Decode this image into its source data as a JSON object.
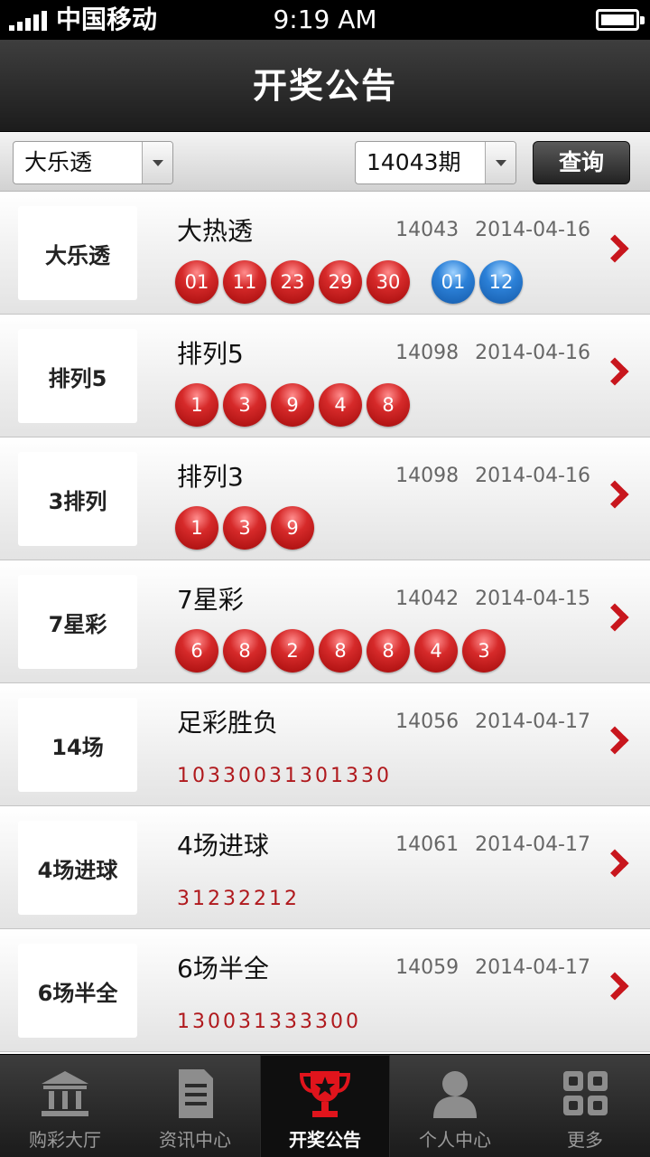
{
  "status_bar": {
    "carrier": "中国移动",
    "time": "9:19 AM",
    "icons": [
      "signal-icon",
      "battery-icon"
    ]
  },
  "header": {
    "title": "开奖公告"
  },
  "filter": {
    "lottery_select": "大乐透",
    "issue_select": "14043期",
    "query_label": "查询"
  },
  "colors": {
    "accent_red": "#c8161d",
    "red_ball": "#c01a1a",
    "blue_ball": "#2371c6",
    "result_text": "#b0191d"
  },
  "results": [
    {
      "name": "大热透",
      "logo_text": "大乐透",
      "logo_icon": "lotto-logo-dlt",
      "issue": "14043",
      "date": "2014-04-16",
      "red": [
        "01",
        "11",
        "23",
        "29",
        "30"
      ],
      "blue": [
        "01",
        "12"
      ]
    },
    {
      "name": "排列5",
      "logo_text": "排列5",
      "logo_icon": "lotto-logo-pl5",
      "issue": "14098",
      "date": "2014-04-16",
      "red": [
        "1",
        "3",
        "9",
        "4",
        "8"
      ],
      "blue": []
    },
    {
      "name": "排列3",
      "logo_text": "3排列",
      "logo_icon": "lotto-logo-pl3",
      "issue": "14098",
      "date": "2014-04-16",
      "red": [
        "1",
        "3",
        "9"
      ],
      "blue": []
    },
    {
      "name": "7星彩",
      "logo_text": "7星彩",
      "logo_icon": "lotto-logo-7xc",
      "issue": "14042",
      "date": "2014-04-15",
      "red": [
        "6",
        "8",
        "2",
        "8",
        "8",
        "4",
        "3"
      ],
      "blue": []
    },
    {
      "name": "足彩胜负",
      "logo_text": "14场",
      "logo_icon": "lotto-logo-14c",
      "issue": "14056",
      "date": "2014-04-17",
      "result_text": "10330031301330"
    },
    {
      "name": "4场进球",
      "logo_text": "4场进球",
      "logo_icon": "lotto-logo-4cjq",
      "issue": "14061",
      "date": "2014-04-17",
      "result_text": "31232212"
    },
    {
      "name": "6场半全",
      "logo_text": "6场半全",
      "logo_icon": "lotto-logo-6cbq",
      "issue": "14059",
      "date": "2014-04-17",
      "result_text": "130031333300"
    }
  ],
  "tabs": [
    {
      "label": "购彩大厅",
      "icon": "bank-icon",
      "active": false
    },
    {
      "label": "资讯中心",
      "icon": "document-icon",
      "active": false
    },
    {
      "label": "开奖公告",
      "icon": "trophy-icon",
      "active": true
    },
    {
      "label": "个人中心",
      "icon": "person-icon",
      "active": false
    },
    {
      "label": "更多",
      "icon": "grid-icon",
      "active": false
    }
  ]
}
